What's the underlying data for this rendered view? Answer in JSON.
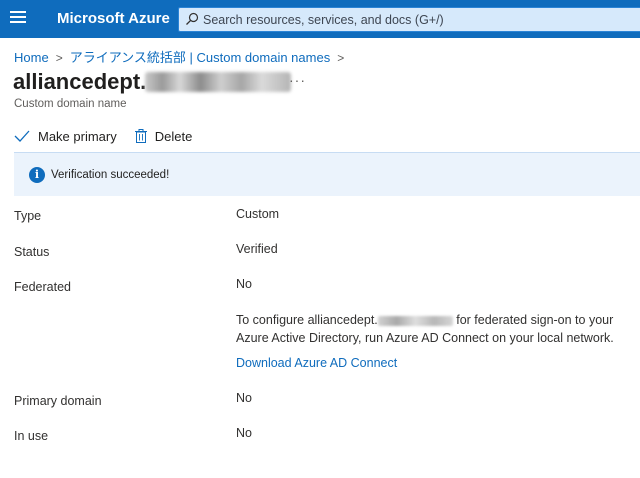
{
  "header": {
    "brand": "Microsoft Azure",
    "search_placeholder": "Search resources, services, and docs (G+/)"
  },
  "breadcrumb": {
    "items": [
      "Home",
      "アライアンス統括部 | Custom domain names"
    ]
  },
  "page": {
    "title": "alliancedept.",
    "subtitle": "Custom domain name",
    "more": "···"
  },
  "toolbar": {
    "make_primary": "Make primary",
    "delete": "Delete"
  },
  "banner": {
    "icon": "info-icon",
    "text": "Verification succeeded!"
  },
  "properties": {
    "type_label": "Type",
    "type_value": "Custom",
    "status_label": "Status",
    "status_value": "Verified",
    "federated_label": "Federated",
    "federated_value": "No",
    "note_part1": "To configure alliancedept.",
    "note_part2": " for federated sign-on to your Azure Active Directory, run Azure AD Connect on your local network.",
    "download_link": "Download Azure AD Connect",
    "primary_label": "Primary domain",
    "primary_value": "No",
    "inuse_label": "In use",
    "inuse_value": "No"
  },
  "colors": {
    "accent": "#0f6cbd",
    "banner_bg": "#ebf3fc"
  }
}
